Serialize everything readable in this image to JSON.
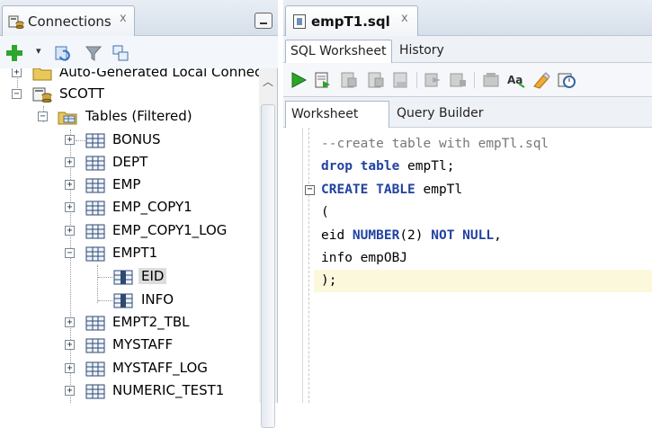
{
  "connections_panel": {
    "tab_label": "Connections",
    "close_glyph": "x",
    "toolbar": {
      "add_icon": "plus-icon",
      "dropdown_glyph": "▾",
      "refresh_icon": "refresh-icon",
      "filter_icon": "filter-icon",
      "schema_browser_icon": "schema-browser-icon"
    },
    "tree": {
      "partial_top": "Auto-Generated Local Connect",
      "connection": "SCOTT",
      "tables_node": "Tables (Filtered)",
      "tables": [
        {
          "name": "BONUS",
          "expanded": false
        },
        {
          "name": "DEPT",
          "expanded": false
        },
        {
          "name": "EMP",
          "expanded": false
        },
        {
          "name": "EMP_COPY1",
          "expanded": false
        },
        {
          "name": "EMP_COPY1_LOG",
          "expanded": false
        },
        {
          "name": "EMPT1",
          "expanded": true
        },
        {
          "name": "EMPT2_TBL",
          "expanded": false
        },
        {
          "name": "MYSTAFF",
          "expanded": false
        },
        {
          "name": "MYSTAFF_LOG",
          "expanded": false
        },
        {
          "name": "NUMERIC_TEST1",
          "expanded": false
        }
      ],
      "columns": [
        "EID",
        "INFO"
      ],
      "expand_glyph": "+",
      "collapse_glyph": "−"
    }
  },
  "editor": {
    "file_tab": "empT1.sql",
    "close_glyph": "x",
    "subtabs": [
      "SQL Worksheet",
      "History"
    ],
    "worksheet_tabs": [
      "Worksheet",
      "Query Builder"
    ],
    "fold_glyph": "−",
    "code_lines": [
      "--create table with empTl.sql",
      "drop table empTl;",
      "CREATE TABLE empTl",
      "(",
      "eid NUMBER(2) NOT NULL,",
      "info empOBJ",
      ");"
    ],
    "toolbar_icons": [
      "run-statement-icon",
      "run-script-icon",
      "autotrace-icon",
      "explain-plan-icon",
      "commit-icon",
      "sql-tuning-icon",
      "rollback-icon",
      "unshared-sql-icon",
      "to-upper-lower-icon",
      "clear-icon",
      "history-icon"
    ]
  },
  "colors": {
    "keyword": "#2142a1",
    "comment": "#777777",
    "current_line": "#fbf8dc",
    "tab_bg": "#d6dfea"
  }
}
